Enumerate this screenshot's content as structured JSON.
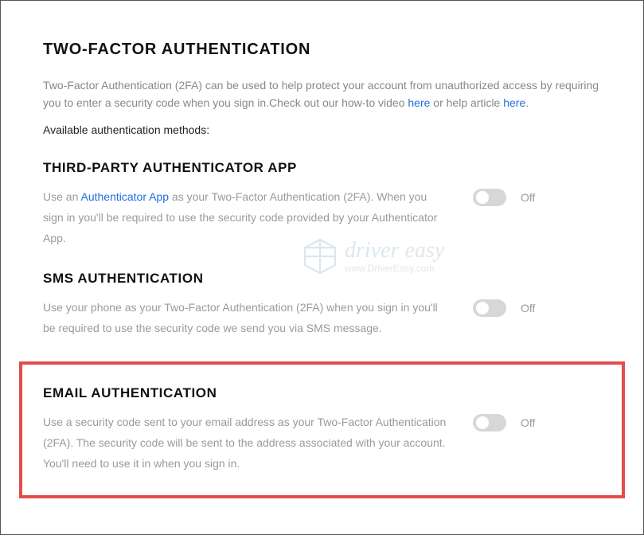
{
  "title": "TWO-FACTOR AUTHENTICATION",
  "desc_part1": "Two-Factor Authentication (2FA) can be used to help protect your account from unauthorized access by requiring you to enter a security code when you sign in.Check out our how-to video ",
  "desc_link1": "here",
  "desc_part2": " or help article ",
  "desc_link2": "here",
  "desc_part3": ".",
  "available_label": "Available authentication methods:",
  "sections": {
    "thirdparty": {
      "title": "THIRD-PARTY AUTHENTICATOR APP",
      "t1": "Use an ",
      "link": "Authenticator App",
      "t2": " as your Two-Factor Authentication (2FA). When you sign in you'll be required to use the security code provided by your Authenticator App.",
      "toggle": "Off"
    },
    "sms": {
      "title": "SMS AUTHENTICATION",
      "text": "Use your phone as your Two-Factor Authentication (2FA) when you sign in you'll be required to use the security code we send you via SMS message.",
      "toggle": "Off"
    },
    "email": {
      "title": "EMAIL AUTHENTICATION",
      "text": "Use a security code sent to your email address as your Two-Factor Authentication (2FA). The security code will be sent to the address associated with your account. You'll need to use it in when you sign in.",
      "toggle": "Off"
    }
  },
  "watermark": {
    "brand1": "driver",
    "brand2": " easy",
    "url": "www.DriverEasy.com"
  }
}
